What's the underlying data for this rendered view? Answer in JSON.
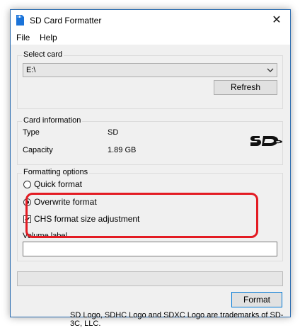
{
  "window": {
    "title": "SD Card Formatter",
    "close_glyph": "✕",
    "app_icon": "sd-card-icon"
  },
  "menu": {
    "items": [
      "File",
      "Help"
    ]
  },
  "select_card": {
    "group_label": "Select card",
    "selected_drive": "E:\\",
    "refresh_label": "Refresh"
  },
  "card_info": {
    "group_label": "Card information",
    "type_label": "Type",
    "type_value": "SD",
    "capacity_label": "Capacity",
    "capacity_value": "1.89 GB",
    "logo": "sd-logo"
  },
  "formatting": {
    "group_label": "Formatting options",
    "quick_format_label": "Quick format",
    "quick_format_selected": false,
    "overwrite_format_label": "Overwrite format",
    "overwrite_format_selected": true,
    "chs_label": "CHS format size adjustment",
    "chs_checked": true,
    "volume_label_caption": "Volume label",
    "volume_label_value": ""
  },
  "progress": {
    "value": 0
  },
  "actions": {
    "format_label": "Format"
  },
  "footer": {
    "trademark_text": "SD Logo, SDHC Logo and SDXC Logo are trademarks of SD-3C, LLC."
  },
  "colors": {
    "highlight": "#e31b23",
    "accent": "#0078d7"
  }
}
